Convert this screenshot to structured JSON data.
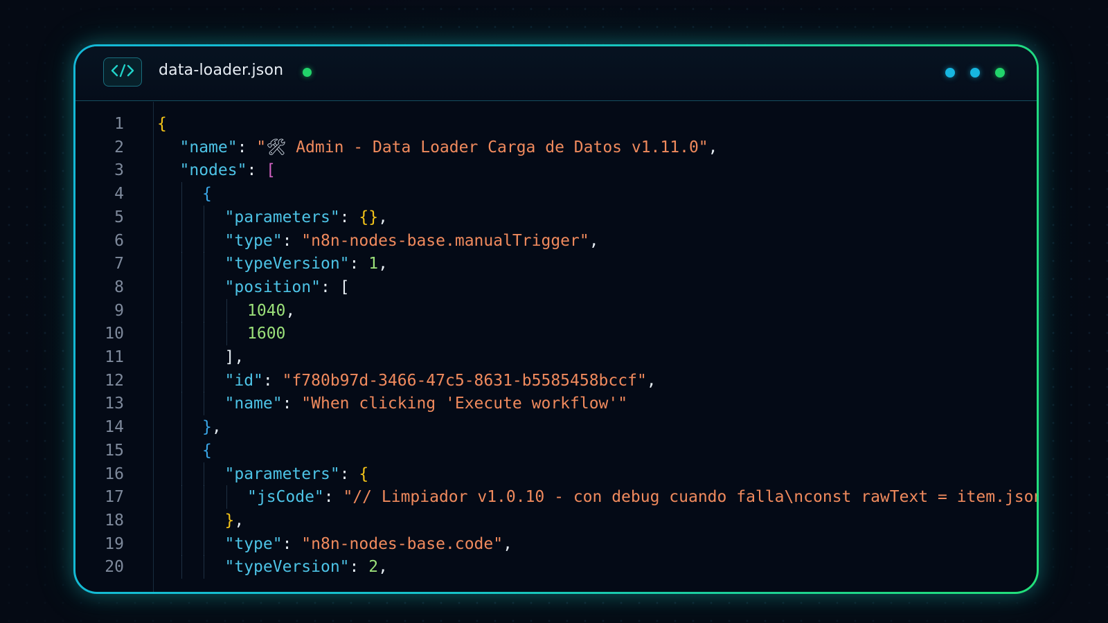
{
  "window": {
    "filename": "data-loader.json",
    "unsaved": true,
    "badge_icon": "code-brackets-icon",
    "control_dots": [
      {
        "name": "dot-1",
        "color": "#17b6e0"
      },
      {
        "name": "dot-2",
        "color": "#17b6e0"
      },
      {
        "name": "dot-3",
        "color": "#22d46b"
      }
    ]
  },
  "colors": {
    "key": "#4dc3e6",
    "string": "#f08a5d",
    "number": "#9be07a",
    "bracket_level_1": "#f5c518",
    "bracket_level_2": "#d462c4",
    "bracket_level_3": "#3aa7e8",
    "frame_start": "#14b8d6",
    "frame_end": "#22e07a"
  },
  "lines": [
    {
      "n": "1",
      "indent": 0,
      "tokens": [
        {
          "t": "{",
          "c": "b1"
        }
      ]
    },
    {
      "n": "2",
      "indent": 1,
      "tokens": [
        {
          "t": "\"name\"",
          "c": "key"
        },
        {
          "t": ": ",
          "c": "punc"
        },
        {
          "t": "\"",
          "c": "str"
        },
        {
          "t": "🛠",
          "c": "emoji"
        },
        {
          "t": " Admin - Data Loader Carga de Datos v1.11.0\"",
          "c": "str"
        },
        {
          "t": ",",
          "c": "punc"
        }
      ]
    },
    {
      "n": "3",
      "indent": 1,
      "tokens": [
        {
          "t": "\"nodes\"",
          "c": "key"
        },
        {
          "t": ": ",
          "c": "punc"
        },
        {
          "t": "[",
          "c": "b2"
        }
      ]
    },
    {
      "n": "4",
      "indent": 2,
      "tokens": [
        {
          "t": "{",
          "c": "b3"
        }
      ]
    },
    {
      "n": "5",
      "indent": 3,
      "tokens": [
        {
          "t": "\"parameters\"",
          "c": "key"
        },
        {
          "t": ": ",
          "c": "punc"
        },
        {
          "t": "{}",
          "c": "b1"
        },
        {
          "t": ",",
          "c": "punc"
        }
      ]
    },
    {
      "n": "6",
      "indent": 3,
      "tokens": [
        {
          "t": "\"type\"",
          "c": "key"
        },
        {
          "t": ": ",
          "c": "punc"
        },
        {
          "t": "\"n8n-nodes-base.manualTrigger\"",
          "c": "str"
        },
        {
          "t": ",",
          "c": "punc"
        }
      ]
    },
    {
      "n": "7",
      "indent": 3,
      "tokens": [
        {
          "t": "\"typeVersion\"",
          "c": "key"
        },
        {
          "t": ": ",
          "c": "punc"
        },
        {
          "t": "1",
          "c": "num"
        },
        {
          "t": ",",
          "c": "punc"
        }
      ]
    },
    {
      "n": "8",
      "indent": 3,
      "tokens": [
        {
          "t": "\"position\"",
          "c": "key"
        },
        {
          "t": ": ",
          "c": "punc"
        },
        {
          "t": "[",
          "c": "punc"
        }
      ]
    },
    {
      "n": "9",
      "indent": 4,
      "tokens": [
        {
          "t": "1040",
          "c": "num"
        },
        {
          "t": ",",
          "c": "punc"
        }
      ]
    },
    {
      "n": "10",
      "indent": 4,
      "tokens": [
        {
          "t": "1600",
          "c": "num"
        }
      ]
    },
    {
      "n": "11",
      "indent": 3,
      "tokens": [
        {
          "t": "],",
          "c": "punc"
        }
      ]
    },
    {
      "n": "12",
      "indent": 3,
      "tokens": [
        {
          "t": "\"id\"",
          "c": "key"
        },
        {
          "t": ": ",
          "c": "punc"
        },
        {
          "t": "\"f780b97d-3466-47c5-8631-b5585458bccf\"",
          "c": "str"
        },
        {
          "t": ",",
          "c": "punc"
        }
      ]
    },
    {
      "n": "13",
      "indent": 3,
      "tokens": [
        {
          "t": "\"name\"",
          "c": "key"
        },
        {
          "t": ": ",
          "c": "punc"
        },
        {
          "t": "\"When clicking 'Execute workflow'\"",
          "c": "str"
        }
      ]
    },
    {
      "n": "14",
      "indent": 2,
      "tokens": [
        {
          "t": "}",
          "c": "b3"
        },
        {
          "t": ",",
          "c": "punc"
        }
      ]
    },
    {
      "n": "15",
      "indent": 2,
      "tokens": [
        {
          "t": "{",
          "c": "b3"
        }
      ]
    },
    {
      "n": "16",
      "indent": 3,
      "tokens": [
        {
          "t": "\"parameters\"",
          "c": "key"
        },
        {
          "t": ": ",
          "c": "punc"
        },
        {
          "t": "{",
          "c": "b1"
        }
      ]
    },
    {
      "n": "17",
      "indent": 4,
      "tokens": [
        {
          "t": "\"jsCode\"",
          "c": "key"
        },
        {
          "t": ": ",
          "c": "punc"
        },
        {
          "t": "\"// Limpiador v1.0.10 - con debug cuando falla\\nconst rawText = item.json...\"",
          "c": "str"
        }
      ]
    },
    {
      "n": "18",
      "indent": 3,
      "tokens": [
        {
          "t": "}",
          "c": "b1"
        },
        {
          "t": ",",
          "c": "punc"
        }
      ]
    },
    {
      "n": "19",
      "indent": 3,
      "tokens": [
        {
          "t": "\"type\"",
          "c": "key"
        },
        {
          "t": ": ",
          "c": "punc"
        },
        {
          "t": "\"n8n-nodes-base.code\"",
          "c": "str"
        },
        {
          "t": ",",
          "c": "punc"
        }
      ]
    },
    {
      "n": "20",
      "indent": 3,
      "tokens": [
        {
          "t": "\"typeVersion\"",
          "c": "key"
        },
        {
          "t": ": ",
          "c": "punc"
        },
        {
          "t": "2",
          "c": "num"
        },
        {
          "t": ",",
          "c": "punc"
        }
      ]
    }
  ]
}
